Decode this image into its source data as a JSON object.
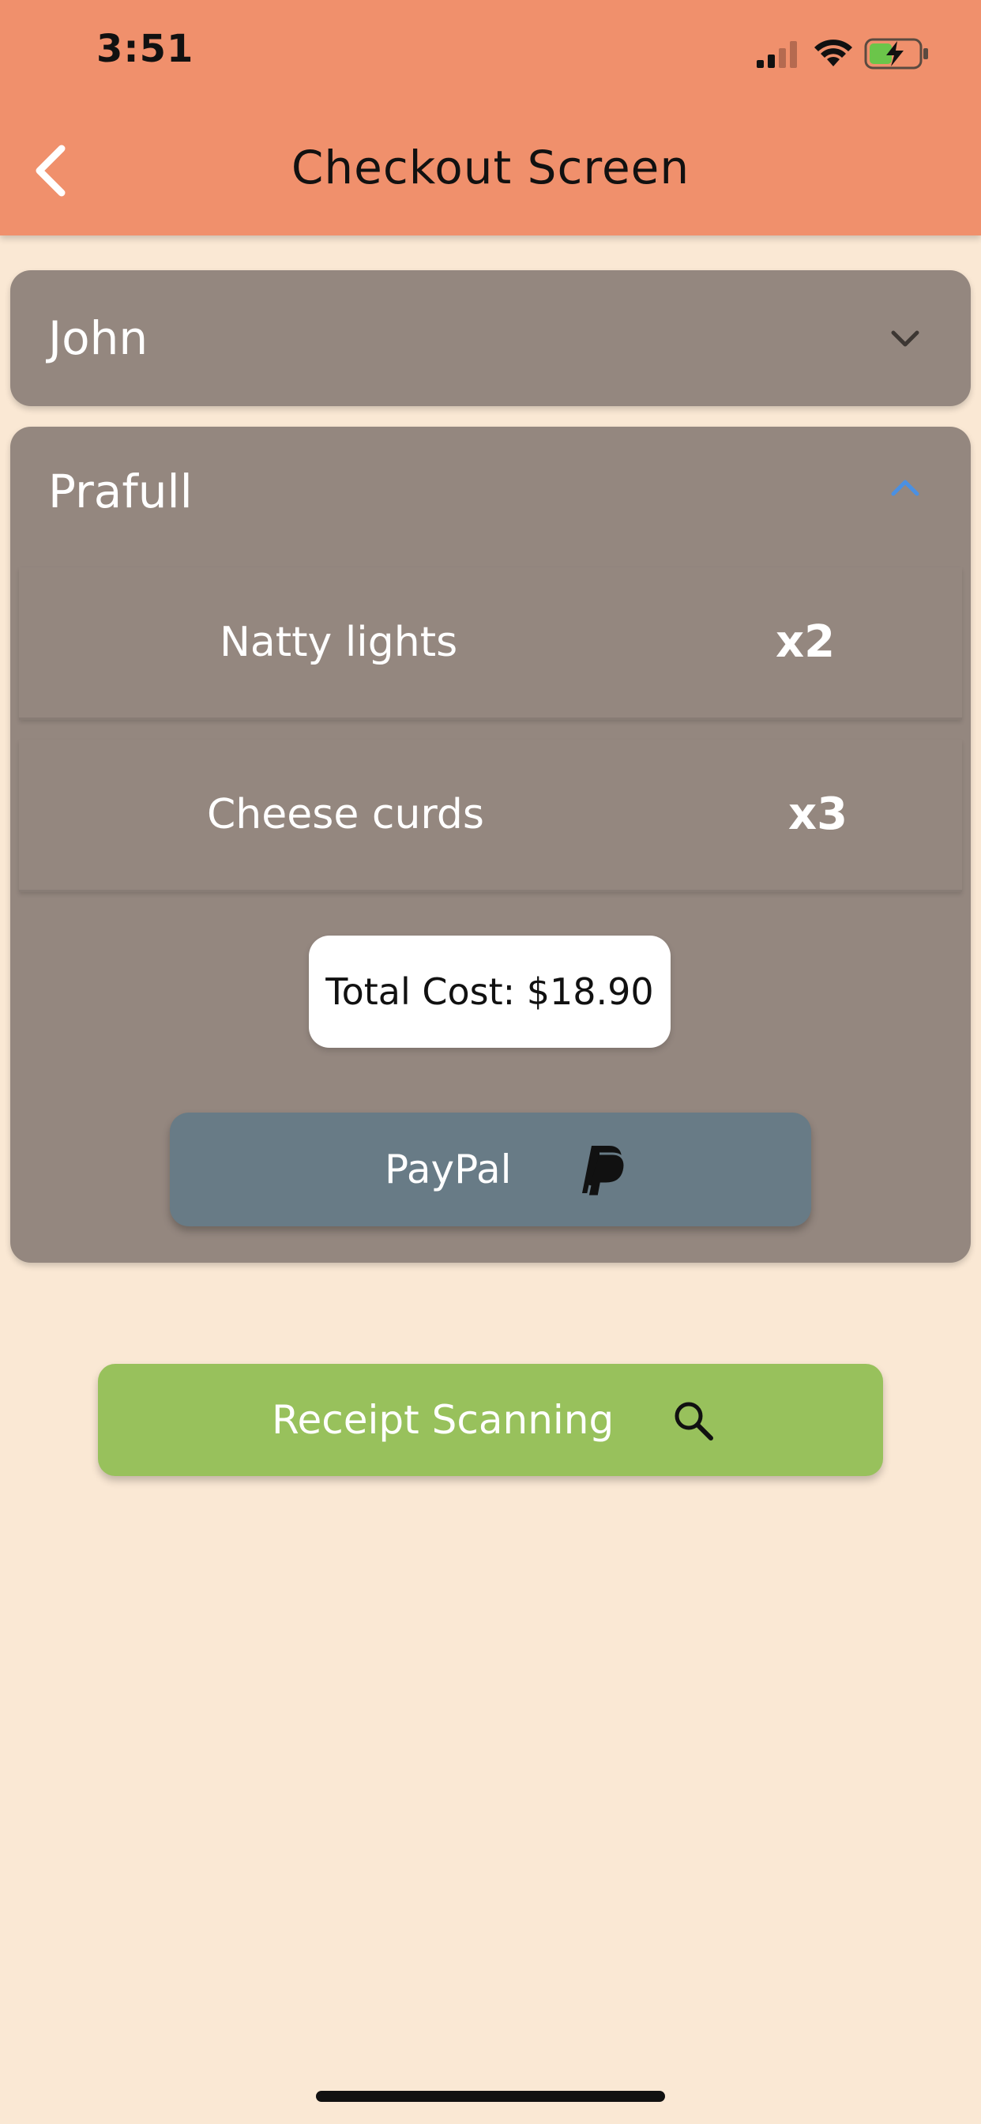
{
  "status_bar": {
    "time": "3:51"
  },
  "header": {
    "title": "Checkout Screen",
    "back_icon": "chevron-left-icon"
  },
  "groups": [
    {
      "name": "John",
      "expanded": false,
      "toggle_icon": "chevron-down-icon"
    },
    {
      "name": "Prafull",
      "expanded": true,
      "toggle_icon": "chevron-up-icon",
      "items": [
        {
          "name": "Natty lights",
          "qty": "x2"
        },
        {
          "name": "Cheese curds",
          "qty": "x3"
        }
      ],
      "total_label": "Total Cost:  $18.90",
      "payment_button": {
        "label": "PayPal",
        "icon": "paypal-icon"
      }
    }
  ],
  "receipt_button": {
    "label": "Receipt Scanning",
    "icon": "search-icon"
  },
  "colors": {
    "header": "#F0906C",
    "background": "#FAE8D4",
    "panel": "#94877F",
    "paypal_button": "#687B86",
    "receipt_button": "#98C15C",
    "accent_chevron": "#4A90E2"
  }
}
